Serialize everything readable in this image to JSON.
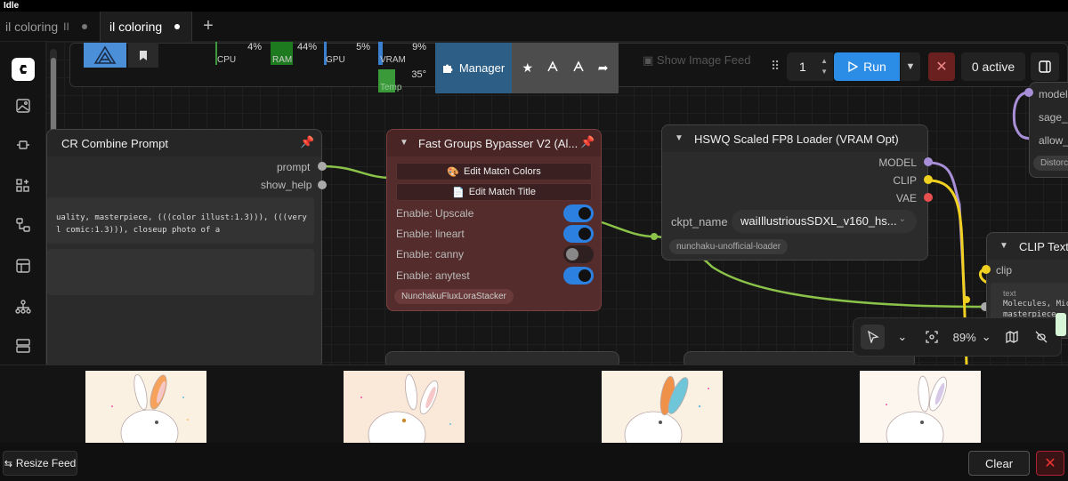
{
  "status": {
    "text": "Idle"
  },
  "tabs": [
    {
      "label": "il coloring",
      "badge": "II"
    },
    {
      "label": "il coloring"
    }
  ],
  "toolbar": {
    "stats": [
      {
        "label": "CPU",
        "value": "4%",
        "color": "#3a9a3a"
      },
      {
        "label": "RAM",
        "value": "44%",
        "color": "#2e8b2e"
      },
      {
        "label": "GPU",
        "value": "5%",
        "color": "#3a7fd0"
      },
      {
        "label": "VRAM",
        "value": "9%",
        "color": "#3a7fd0"
      },
      {
        "label": "Temp",
        "value": "35°",
        "color": "#3a9a3a"
      }
    ],
    "manager_label": "Manager",
    "show_feed_label": "Show Image Feed",
    "queue_count": "1",
    "run_label": "Run",
    "active_label": "0 active"
  },
  "nodes": {
    "cr_combine": {
      "title": "CR Combine Prompt",
      "outputs": [
        "prompt",
        "show_help"
      ],
      "text_line1": "uality, masterpiece, (((color illust:1.3))), (((very",
      "text_line2": "l comic:1.3))), closeup photo of a"
    },
    "fgb": {
      "title": "Fast Groups Bypasser V2 (Al...",
      "btn_colors": "Edit Match Colors",
      "btn_title": "Edit Match Title",
      "rows": [
        {
          "label": "Enable: Upscale",
          "on": true
        },
        {
          "label": "Enable: lineart",
          "on": true
        },
        {
          "label": "Enable: canny",
          "on": false
        },
        {
          "label": "Enable: anytest",
          "on": true
        }
      ],
      "badge": "NunchakuFluxLoraStacker"
    },
    "hswq": {
      "title": "HSWQ Scaled FP8 Loader (VRAM Opt)",
      "outputs": [
        "MODEL",
        "CLIP",
        "VAE"
      ],
      "ckpt_label": "ckpt_name",
      "ckpt_value": "waiIllustriousSDXL_v160_hs...",
      "badge": "nunchaku-unofficial-loader"
    },
    "clip": {
      "title": "CLIP Text",
      "input": "clip",
      "text_label": "text",
      "text_line1": "Molecules, Mic",
      "text_line2": "masterpiece,"
    },
    "misc": {
      "items": [
        "model",
        "sage_",
        "allow_",
        "Distorc"
      ]
    }
  },
  "zoom": {
    "level": "89%"
  },
  "feed": {
    "images": [
      "bunny-1",
      "bunny-2",
      "bunny-3",
      "bunny-4"
    ],
    "resize_label": "Resize Feed",
    "clear_label": "Clear"
  },
  "colors": {
    "accent": "#2b8de6",
    "model_port": "#a98fd8",
    "clip_port": "#f0d020",
    "vae_port": "#e85050",
    "link_green": "#8bc34a"
  }
}
